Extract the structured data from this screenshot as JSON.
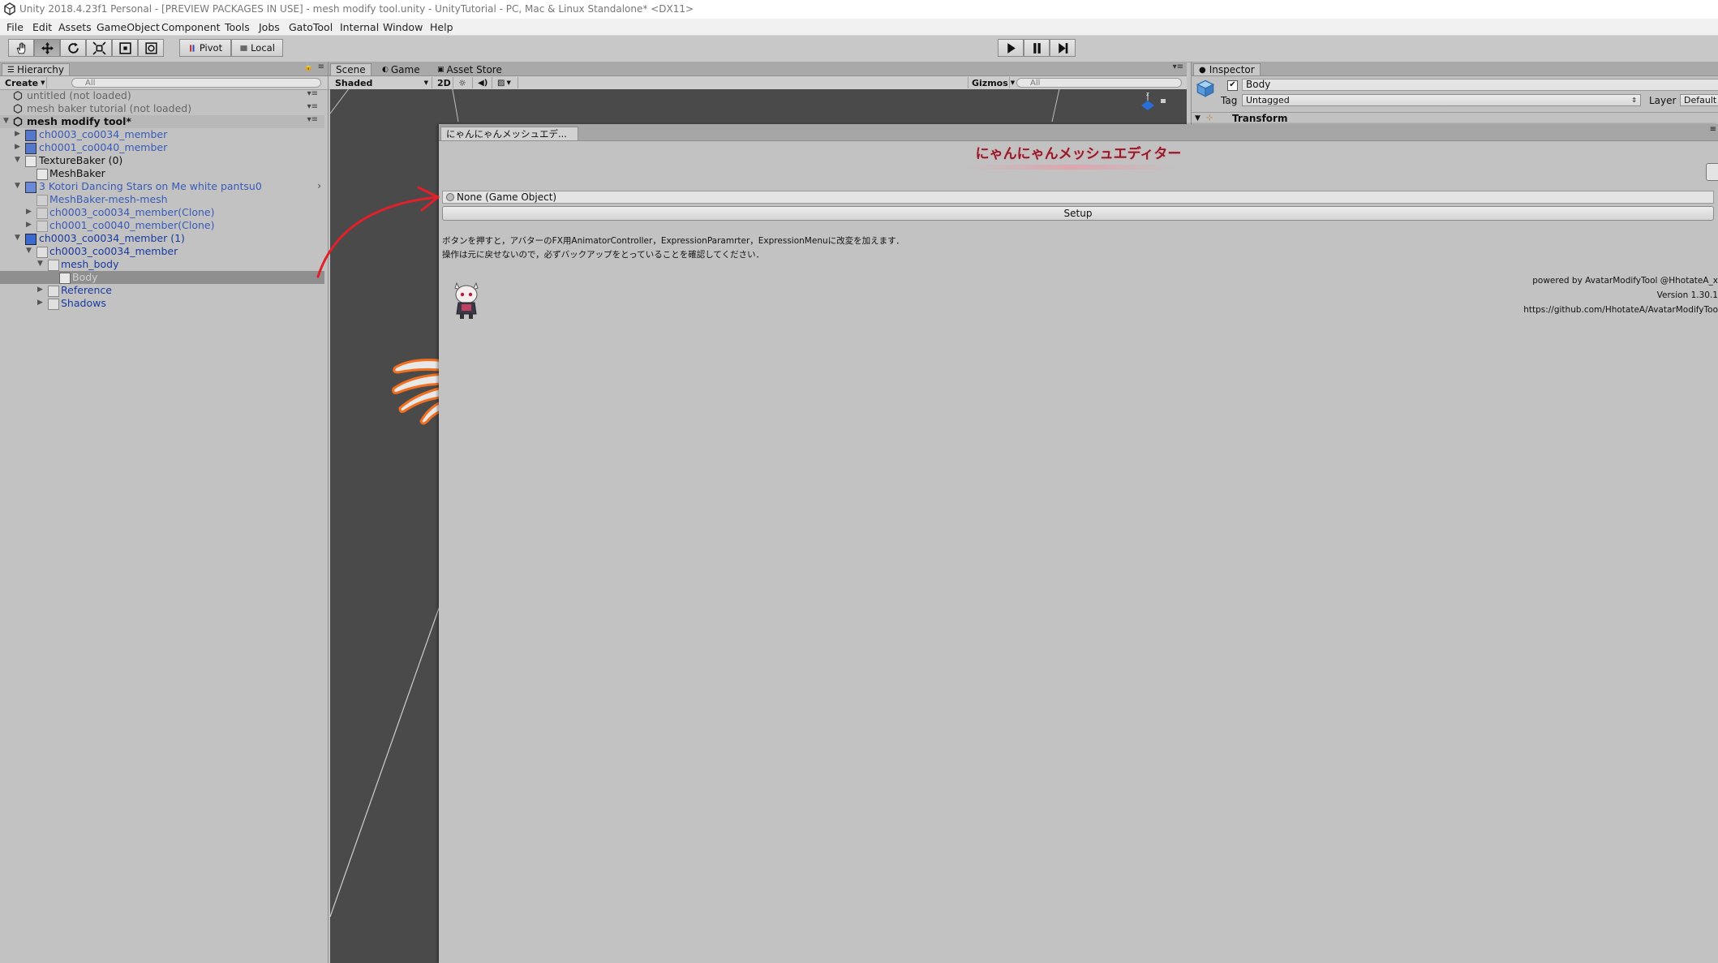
{
  "window": {
    "title": "Unity 2018.4.23f1 Personal - [PREVIEW PACKAGES IN USE] - mesh modify tool.unity - UnityTutorial - PC, Mac & Linux Standalone* <DX11>"
  },
  "menu": [
    "File",
    "Edit",
    "Assets",
    "GameObject",
    "Component",
    "Tools",
    "Jobs",
    "GatoTool",
    "Internal",
    "Window",
    "Help"
  ],
  "toolbar": {
    "pivot_label": "Pivot",
    "local_label": "Local"
  },
  "hierarchy": {
    "tab_label": "Hierarchy",
    "create_label": "Create",
    "search_placeholder": "All",
    "rows": [
      {
        "label": "untitled (not loaded)"
      },
      {
        "label": "mesh baker tutorial (not loaded)"
      },
      {
        "label": "mesh modify tool*"
      },
      {
        "label": "ch0003_co0034_member"
      },
      {
        "label": "ch0001_co0040_member"
      },
      {
        "label": "TextureBaker (0)"
      },
      {
        "label": "MeshBaker"
      },
      {
        "label": "3 Kotori Dancing Stars on Me white pantsu0"
      },
      {
        "label": "MeshBaker-mesh-mesh"
      },
      {
        "label": "ch0003_co0034_member(Clone)"
      },
      {
        "label": "ch0001_co0040_member(Clone)"
      },
      {
        "label": "ch0003_co0034_member (1)"
      },
      {
        "label": "ch0003_co0034_member"
      },
      {
        "label": "mesh_body"
      },
      {
        "label": "Body"
      },
      {
        "label": "Reference"
      },
      {
        "label": "Shadows"
      }
    ]
  },
  "scene": {
    "tabs": [
      "Scene",
      "Game",
      "Asset Store"
    ],
    "shading": "Shaded",
    "mode_2d": "2D",
    "gizmos": "Gizmos",
    "search_placeholder": "All"
  },
  "inspector": {
    "tab_label": "Inspector",
    "object_name": "Body",
    "tag_label": "Tag",
    "tag_value": "Untagged",
    "layer_label": "Layer",
    "layer_value": "Default",
    "component": "Transform"
  },
  "editor": {
    "tab_label": "にゃんにゃんメッシュエデ...",
    "title": "にゃんにゃんメッシュエディター",
    "field_value": "None (Game Object)",
    "setup_label": "Setup",
    "desc1": "ボタンを押すと，アバターのFX用AnimatorController，ExpressionParamrter，ExpressionMenuに改変を加えます．",
    "desc2": "操作は元に戻せないので，必ずバックアップをとっていることを確認してください．",
    "powered": "powered by AvatarModifyTool @HhotateA_x",
    "version": "Version 1.30.1",
    "url": "https://github.com/HhotateA/AvatarModifyToo"
  },
  "colors": {
    "title_red": "#8b1e2b",
    "link_blue": "#1a3aa0",
    "prefab_blue": "#3a5ab8",
    "arrow_red": "#e0202a"
  }
}
